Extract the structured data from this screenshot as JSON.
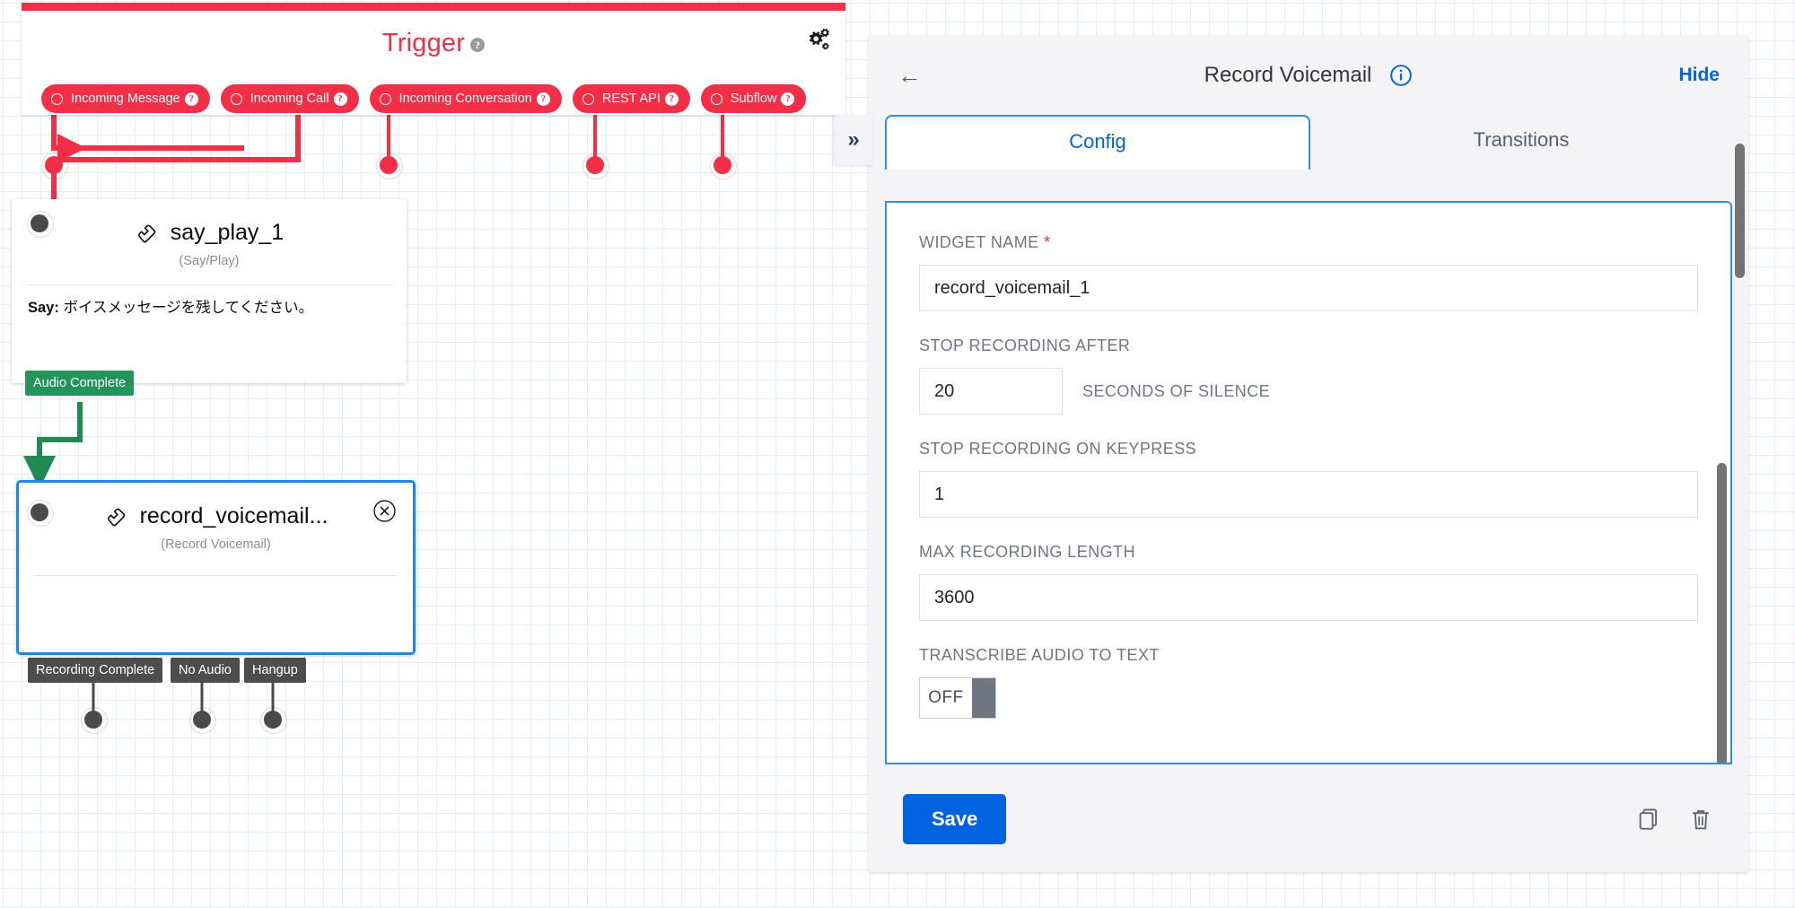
{
  "canvas": {
    "trigger": {
      "title": "Trigger",
      "help_icon": "question-mark-icon",
      "gear_icon": "gears-icon",
      "accent_color": "#f22f46",
      "pills": [
        {
          "label": "Incoming Message"
        },
        {
          "label": "Incoming Call"
        },
        {
          "label": "Incoming Conversation"
        },
        {
          "label": "REST API"
        },
        {
          "label": "Subflow"
        }
      ]
    },
    "nodes": [
      {
        "name": "say_play_1",
        "type": "(Say/Play)",
        "icon": "phone-handset-icon",
        "body_label": "Say:",
        "body_text": "ボイスメッセージを残してください。",
        "transitions": [
          {
            "label": "Audio Complete",
            "color": "#24955a"
          }
        ]
      },
      {
        "name": "record_voicemail...",
        "type": "(Record Voicemail)",
        "icon": "phone-handset-icon",
        "close_icon": "close-circle-icon",
        "selected_color": "#1f87e5",
        "transitions": [
          {
            "label": "Recording Complete",
            "color": "#4d4d4d"
          },
          {
            "label": "No Audio",
            "color": "#4d4d4d"
          },
          {
            "label": "Hangup",
            "color": "#4d4d4d"
          }
        ]
      }
    ],
    "collapse_button": {
      "icon": "double-chevron-right-icon",
      "label": "»"
    }
  },
  "panel": {
    "back_icon": "arrow-left-icon",
    "back_label": "←",
    "title": "Record Voicemail",
    "info_icon": "info-circle-icon",
    "hide_label": "Hide",
    "tabs": [
      {
        "label": "Config",
        "active": true
      },
      {
        "label": "Transitions",
        "active": false
      }
    ],
    "fields": [
      {
        "label": "WIDGET NAME",
        "required": true,
        "value": "record_voicemail_1"
      },
      {
        "label": "STOP RECORDING AFTER",
        "required": false,
        "value": "20",
        "suffix": "SECONDS OF SILENCE"
      },
      {
        "label": "STOP RECORDING ON KEYPRESS",
        "required": false,
        "value": "1"
      },
      {
        "label": "MAX RECORDING LENGTH",
        "required": false,
        "value": "3600"
      },
      {
        "label": "TRANSCRIBE AUDIO TO TEXT",
        "required": false,
        "value": "OFF"
      }
    ],
    "footer": {
      "save_label": "Save",
      "copy_icon": "copy-icon",
      "delete_icon": "trash-icon"
    },
    "accent_color": "#0263e0"
  }
}
